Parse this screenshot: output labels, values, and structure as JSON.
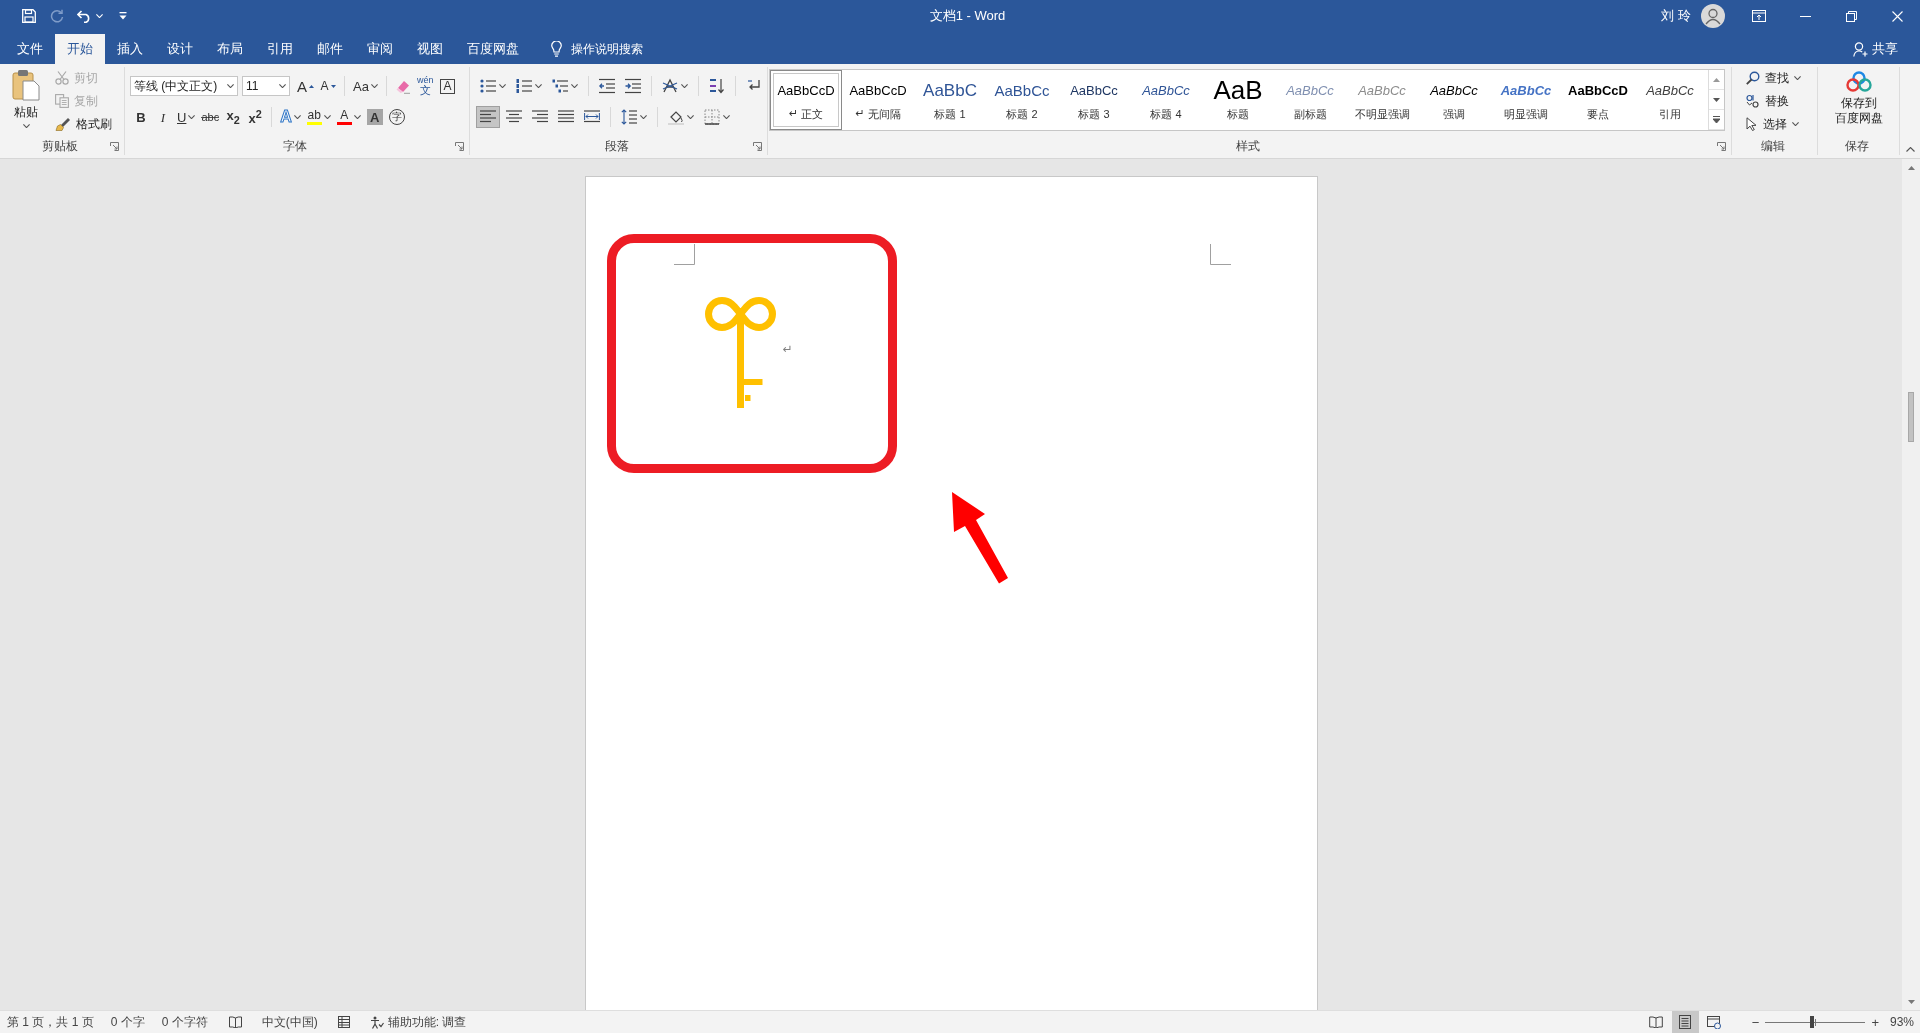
{
  "quick_access": [
    {
      "kind": "save",
      "disabled": false
    },
    {
      "kind": "redo",
      "disabled": true
    },
    {
      "kind": "undo",
      "disabled": false
    },
    {
      "kind": "customize",
      "disabled": false
    }
  ],
  "window": {
    "title": "文档1 - Word",
    "user": "刘 玲"
  },
  "tabs": [
    {
      "label": "文件",
      "selected": false
    },
    {
      "label": "开始",
      "selected": true
    },
    {
      "label": "插入",
      "selected": false
    },
    {
      "label": "设计",
      "selected": false
    },
    {
      "label": "布局",
      "selected": false
    },
    {
      "label": "引用",
      "selected": false
    },
    {
      "label": "邮件",
      "selected": false
    },
    {
      "label": "审阅",
      "selected": false
    },
    {
      "label": "视图",
      "selected": false
    },
    {
      "label": "百度网盘",
      "selected": false
    }
  ],
  "tell_me": "操作说明搜索",
  "share": "共享",
  "clipboard": {
    "label": "剪贴板",
    "paste": "粘贴",
    "items": [
      {
        "kind": "cut",
        "label": "剪切",
        "disabled": true
      },
      {
        "kind": "copy",
        "label": "复制",
        "disabled": true
      },
      {
        "kind": "painter",
        "label": "格式刷",
        "disabled": false
      }
    ]
  },
  "font": {
    "label": "字体",
    "font_name": "等线 (中文正文)",
    "font_size": "11",
    "row1": [
      {
        "kind": "grow",
        "glyph": "A"
      },
      {
        "kind": "shrink",
        "glyph": "A"
      },
      {
        "kind": "case",
        "glyph": "Aa"
      },
      {
        "kind": "clear"
      },
      {
        "kind": "phonetic",
        "glyph": "wén",
        "sub": "文"
      },
      {
        "kind": "border",
        "glyph": "A"
      }
    ],
    "row2": [
      {
        "kind": "bold",
        "glyph": "B"
      },
      {
        "kind": "italic",
        "glyph": "I"
      },
      {
        "kind": "underline",
        "glyph": "U"
      },
      {
        "kind": "strike",
        "glyph": "abc"
      },
      {
        "kind": "subscript",
        "glyph": "x$_{2}$"
      },
      {
        "kind": "superscript",
        "glyph": "x$^{2}$"
      },
      {
        "kind": "effect",
        "glyph": "A"
      },
      {
        "kind": "highlight",
        "glyph": "ab",
        "color": "#ffff00"
      },
      {
        "kind": "color",
        "glyph": "A",
        "color": "#ff0000"
      },
      {
        "kind": "shading",
        "glyph": "A"
      },
      {
        "kind": "enclose",
        "glyph": "字"
      }
    ]
  },
  "paragraph": {
    "label": "段落",
    "alignments": [
      {
        "kind": "left",
        "selected": true
      },
      {
        "kind": "center",
        "selected": false
      },
      {
        "kind": "right",
        "selected": false
      },
      {
        "kind": "justify",
        "selected": false
      },
      {
        "kind": "distributed",
        "selected": false
      }
    ]
  },
  "styles": {
    "label": "样式",
    "items": [
      {
        "kind": "normal",
        "preview": "AaBbCcD",
        "mark": "↵",
        "name": "正文",
        "selected": true
      },
      {
        "kind": "no_spacing",
        "preview": "AaBbCcD",
        "mark": "↵",
        "name": "无间隔",
        "selected": false
      },
      {
        "kind": "heading1",
        "preview": "AaBbC",
        "name": "标题 1",
        "selected": false
      },
      {
        "kind": "heading2",
        "preview": "AaBbCc",
        "name": "标题 2",
        "selected": false
      },
      {
        "kind": "heading3",
        "preview": "AaBbCc",
        "name": "标题 3",
        "selected": false
      },
      {
        "kind": "heading4",
        "preview": "AaBbCc",
        "name": "标题 4",
        "selected": false
      },
      {
        "kind": "title",
        "preview": "AaB",
        "name": "标题",
        "selected": false
      },
      {
        "kind": "subtitle",
        "preview": "AaBbCc",
        "name": "副标题",
        "selected": false
      },
      {
        "kind": "subtle",
        "preview": "AaBbCc",
        "name": "不明显强调",
        "selected": false
      },
      {
        "kind": "emphasis",
        "preview": "AaBbCc",
        "name": "强调",
        "selected": false
      },
      {
        "kind": "intense",
        "preview": "AaBbCc",
        "name": "明显强调",
        "selected": false
      },
      {
        "kind": "strong",
        "preview": "AaBbCcD",
        "name": "要点",
        "selected": false
      },
      {
        "kind": "quote",
        "preview": "AaBbCc",
        "name": "引用",
        "selected": false
      }
    ]
  },
  "editing": {
    "label": "编辑",
    "items": [
      {
        "kind": "find",
        "label": "查找",
        "dropdown": true
      },
      {
        "kind": "replace",
        "label": "替换",
        "dropdown": false
      },
      {
        "kind": "select",
        "label": "选择",
        "dropdown": true
      }
    ]
  },
  "save": {
    "label": "保存",
    "button_lines": [
      "保存到",
      "百度网盘"
    ]
  },
  "document": {
    "paragraph_mark": "↵"
  },
  "status_bar": {
    "page": "第 1 页，共 1 页",
    "words": "0 个字",
    "chars": "0 个字符",
    "language": "中文(中国)",
    "accessibility": "辅助功能: 调查",
    "views": [
      {
        "kind": "read",
        "selected": false
      },
      {
        "kind": "print",
        "selected": true
      },
      {
        "kind": "web",
        "selected": false
      }
    ],
    "zoom": {
      "minus": "−",
      "plus": "+",
      "level": 0.47,
      "reading": "93%"
    }
  }
}
